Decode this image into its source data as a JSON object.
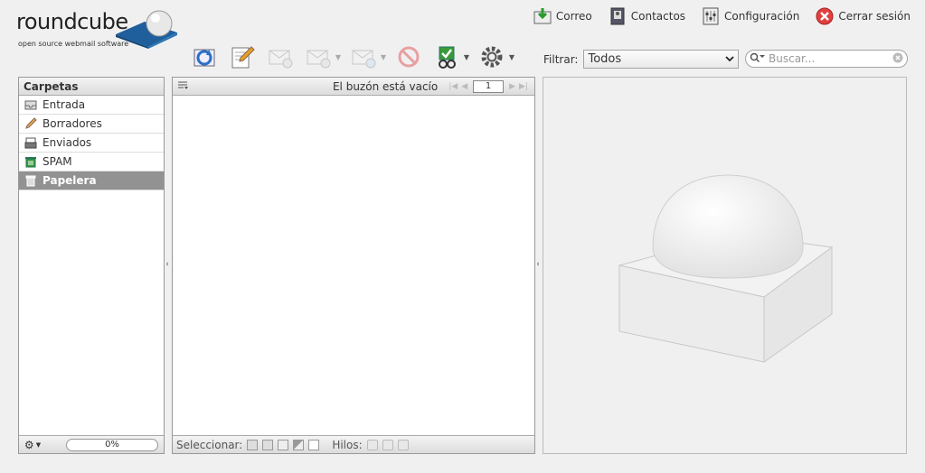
{
  "app": {
    "logo_text": "roundcube",
    "logo_tagline": "open source webmail software"
  },
  "topnav": [
    {
      "label": "Correo",
      "icon": "mail-download-icon"
    },
    {
      "label": "Contactos",
      "icon": "address-book-icon"
    },
    {
      "label": "Configuración",
      "icon": "settings-panel-icon"
    },
    {
      "label": "Cerrar sesión",
      "icon": "logout-icon"
    }
  ],
  "toolbar": {
    "buttons": [
      "refresh-icon",
      "compose-icon",
      "reply-icon",
      "reply-all-icon",
      "forward-icon",
      "delete-icon",
      "mark-icon",
      "more-icon"
    ]
  },
  "filter": {
    "label": "Filtrar:",
    "value": "Todos"
  },
  "search": {
    "placeholder": "Buscar..."
  },
  "folders": {
    "header": "Carpetas",
    "items": [
      {
        "label": "Entrada",
        "icon": "inbox-icon"
      },
      {
        "label": "Borradores",
        "icon": "pencil-icon"
      },
      {
        "label": "Enviados",
        "icon": "sent-icon"
      },
      {
        "label": "SPAM",
        "icon": "spam-icon"
      },
      {
        "label": "Papelera",
        "icon": "trash-icon",
        "selected": true
      }
    ],
    "quota": "0%"
  },
  "messages": {
    "status": "El buzón está vacío",
    "page": "1",
    "footer_select_label": "Seleccionar:",
    "footer_threads_label": "Hilos:"
  },
  "colors": {
    "selected_folder_bg": "#929292",
    "logo_blue": "#2f6da8",
    "delete_red": "#e04040"
  }
}
